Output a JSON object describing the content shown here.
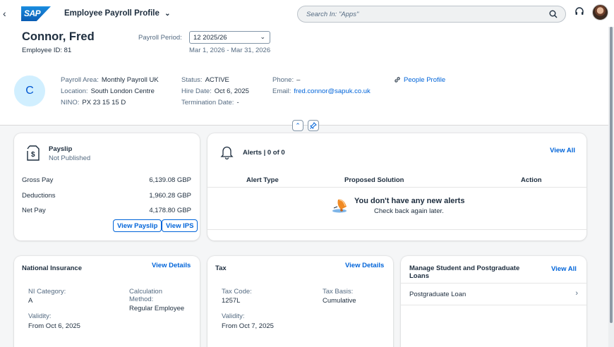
{
  "shell": {
    "logo_text": "SAP",
    "app_title": "Employee Payroll Profile",
    "search_placeholder": "Search In: \"Apps\""
  },
  "header": {
    "name": "Connor, Fred",
    "employee_id_label": "Employee ID:",
    "employee_id": "81",
    "payroll_period_label": "Payroll Period:",
    "payroll_period_value": "12 2025/26",
    "payroll_period_range": "Mar 1, 2026 - Mar 31, 2026",
    "initials": "C",
    "payroll_area_label": "Payroll Area:",
    "payroll_area": "Monthly Payroll UK",
    "location_label": "Location:",
    "location": "South London Centre",
    "nino_label": "NINO:",
    "nino": "PX 23 15 15 D",
    "status_label": "Status:",
    "status": "ACTIVE",
    "hire_date_label": "Hire Date:",
    "hire_date": "Oct 6, 2025",
    "termination_label": "Termination Date:",
    "termination": "-",
    "phone_label": "Phone:",
    "phone": "–",
    "email_label": "Email:",
    "email": "fred.connor@sapuk.co.uk",
    "people_profile": "People Profile"
  },
  "payslip": {
    "title": "Payslip",
    "subtitle": "Not Published",
    "rows": [
      {
        "label": "Gross Pay",
        "value": "6,139.08 GBP"
      },
      {
        "label": "Deductions",
        "value": "1,960.28 GBP"
      },
      {
        "label": "Net Pay",
        "value": "4,178.80 GBP"
      }
    ],
    "view_payslip": "View Payslip",
    "view_ips": "View IPS"
  },
  "alerts": {
    "title": "Alerts | 0 of 0",
    "view_all": "View All",
    "col_type": "Alert Type",
    "col_solution": "Proposed Solution",
    "col_action": "Action",
    "empty_title": "You don't have any new alerts",
    "empty_sub": "Check back again later."
  },
  "ni": {
    "title": "National Insurance",
    "view_details": "View Details",
    "category_label": "NI Category:",
    "category": "A",
    "calc_label": "Calculation Method:",
    "calc": "Regular Employee",
    "validity_label": "Validity:",
    "validity": "From Oct 6, 2025"
  },
  "tax": {
    "title": "Tax",
    "view_details": "View Details",
    "code_label": "Tax Code:",
    "code": "1257L",
    "basis_label": "Tax Basis:",
    "basis": "Cumulative",
    "validity_label": "Validity:",
    "validity": "From Oct 7, 2025"
  },
  "loans": {
    "title": "Manage Student and Postgraduate Loans",
    "view_all": "View All",
    "item": "Postgraduate Loan"
  }
}
